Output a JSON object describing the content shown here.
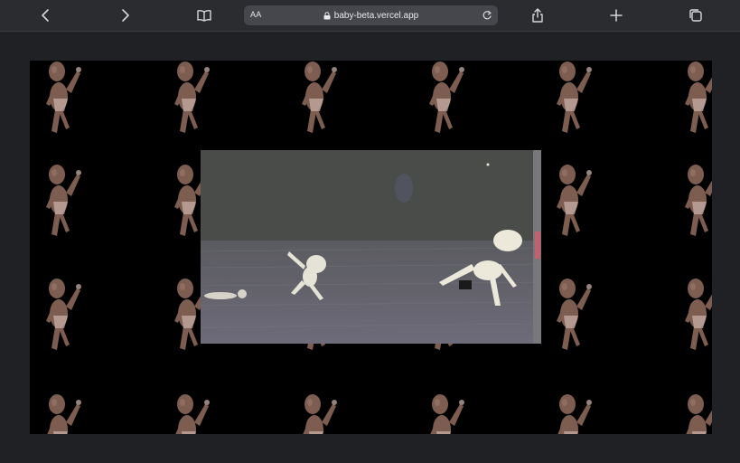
{
  "browser": {
    "url": "baby-beta.vercel.app",
    "reader_label": "AA",
    "icons": [
      "back-icon",
      "forward-icon",
      "bookmarks-icon",
      "lock-icon",
      "reload-icon",
      "share-icon",
      "new-tab-icon",
      "tabs-icon"
    ]
  },
  "page": {
    "background": "#000000",
    "pattern": "dancing-baby-figure",
    "video": "dancing-baby-video"
  }
}
